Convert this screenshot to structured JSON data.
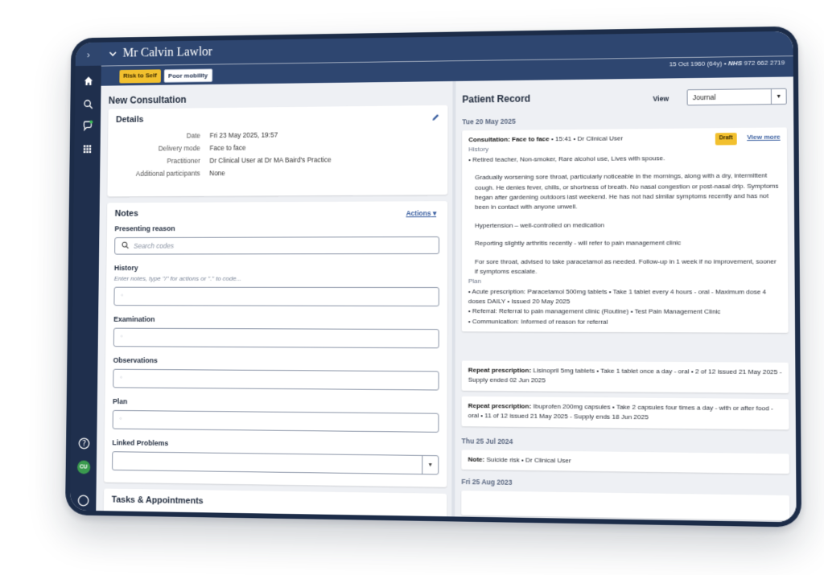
{
  "header": {
    "patient_name": "Mr Calvin Lawlor",
    "badges": [
      "Risk to Self",
      "Poor mobility"
    ],
    "dob": "15 Oct 1960 (64y)",
    "nhs_label": "NHS",
    "nhs_number": "972 662 2719"
  },
  "consultation": {
    "title": "New Consultation",
    "details": {
      "heading": "Details",
      "rows": [
        {
          "label": "Date",
          "value": "Fri 23 May 2025, 19:57"
        },
        {
          "label": "Delivery mode",
          "value": "Face to face"
        },
        {
          "label": "Practitioner",
          "value": "Dr Clinical User at Dr MA Baird's Practice"
        },
        {
          "label": "Additional participants",
          "value": "None"
        }
      ]
    },
    "notes": {
      "heading": "Notes",
      "actions_label": "Actions",
      "presenting_reason_label": "Presenting reason",
      "search_placeholder": "Search codes",
      "history_label": "History",
      "history_hint": "Enter notes, type \"/\" for actions or \".\" to code...",
      "examination_label": "Examination",
      "observations_label": "Observations",
      "plan_label": "Plan",
      "linked_problems_label": "Linked Problems",
      "field_marker": "°"
    },
    "tasks_heading": "Tasks & Appointments"
  },
  "record": {
    "title": "Patient Record",
    "view_label": "View",
    "view_value": "Journal",
    "date1": "Tue 20 May 2025",
    "entry1": {
      "type": "Consultation: Face to face",
      "meta": " • 15:41 • Dr Clinical User",
      "draft": "Draft",
      "view_more": "View more",
      "history_label": "History",
      "social": "• Retired teacher, Non-smoker, Rare alcohol use, Lives with spouse.",
      "para1": "Gradually worsening sore throat, particularly noticeable in the mornings, along with a dry, intermittent cough. He denies fever, chills, or shortness of breath. No nasal congestion or post-nasal drip. Symptoms began after gardening outdoors last weekend. He has not had similar symptoms recently and has not been in contact with anyone unwell.",
      "para2": "Hypertension – well-controlled on medication",
      "para3": "Reporting slightly arthritis recently - will refer to pain management clinic",
      "para4": "For sore throat, advised to take paracetamol as needed. Follow-up in 1 week if no improvement, sooner if symptoms escalate.",
      "plan_label": "Plan",
      "plan1": "• Acute prescription: Paracetamol 500mg tablets • Take 1 tablet every 4 hours - oral - Maximum dose 4 doses DAILY • Issued 20 May 2025",
      "plan2": "• Referral: Referral to pain management clinic (Routine) • Test Pain Management Clinic",
      "plan3": "• Communication: Informed of reason for referral"
    },
    "repeat1": {
      "label": "Repeat prescription:",
      "text": " Lisinopril 5mg tablets • Take 1 tablet once a day - oral • 2 of 12 issued 21 May 2025 - Supply ended 02 Jun 2025"
    },
    "repeat2": {
      "label": "Repeat prescription:",
      "text": " Ibuprofen 200mg capsules • Take 2 capsules four times a day - with or after food - oral • 11 of 12 issued 21 May 2025 - Supply ends 18 Jun 2025"
    },
    "date2": "Thu 25 Jul 2024",
    "note": {
      "label": "Note:",
      "text": " Suicide risk • Dr Clinical User"
    },
    "date3": "Fri 25 Aug 2023"
  }
}
